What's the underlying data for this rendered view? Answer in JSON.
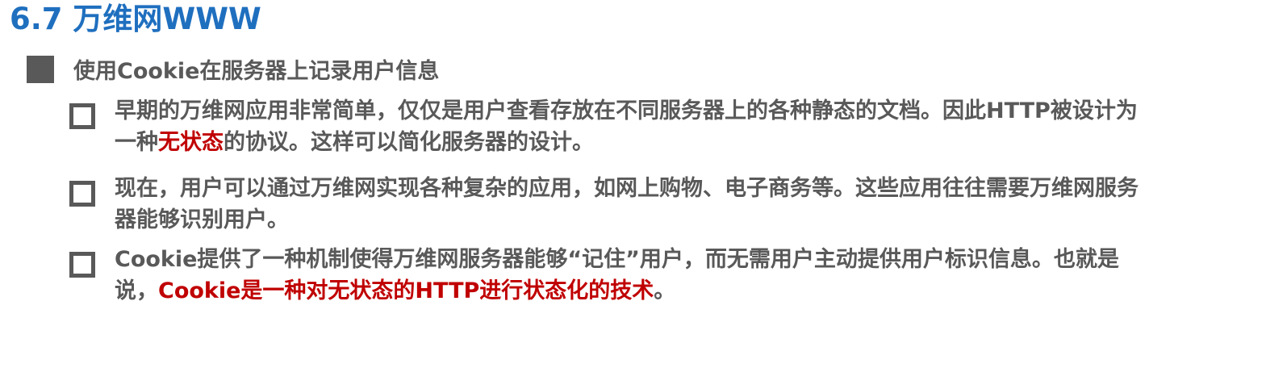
{
  "title": "6.7 万维网WWW",
  "section": {
    "heading": "使用Cookie在服务器上记录用户信息"
  },
  "items": [
    {
      "line1": "早期的万维网应用非常简单，仅仅是用户查看存放在不同服务器上的各种静态的文档。因此HTTP被设计为",
      "line2_pre": "一种",
      "line2_highlight": "无状态",
      "line2_post": "的协议。这样可以简化服务器的设计。"
    },
    {
      "line1": "现在，用户可以通过万维网实现各种复杂的应用，如网上购物、电子商务等。这些应用往往需要万维网服务",
      "line2": "器能够识别用户。"
    },
    {
      "line1": "Cookie提供了一种机制使得万维网服务器能够“记住”用户，而无需用户主动提供用户标识信息。也就是",
      "line2_pre": "说，",
      "line2_highlight": "Cookie是一种对无状态的HTTP进行状态化的技术",
      "line2_post": "。"
    }
  ],
  "colors": {
    "title": "#1f6fbf",
    "text": "#595959",
    "highlight": "#c00000"
  }
}
